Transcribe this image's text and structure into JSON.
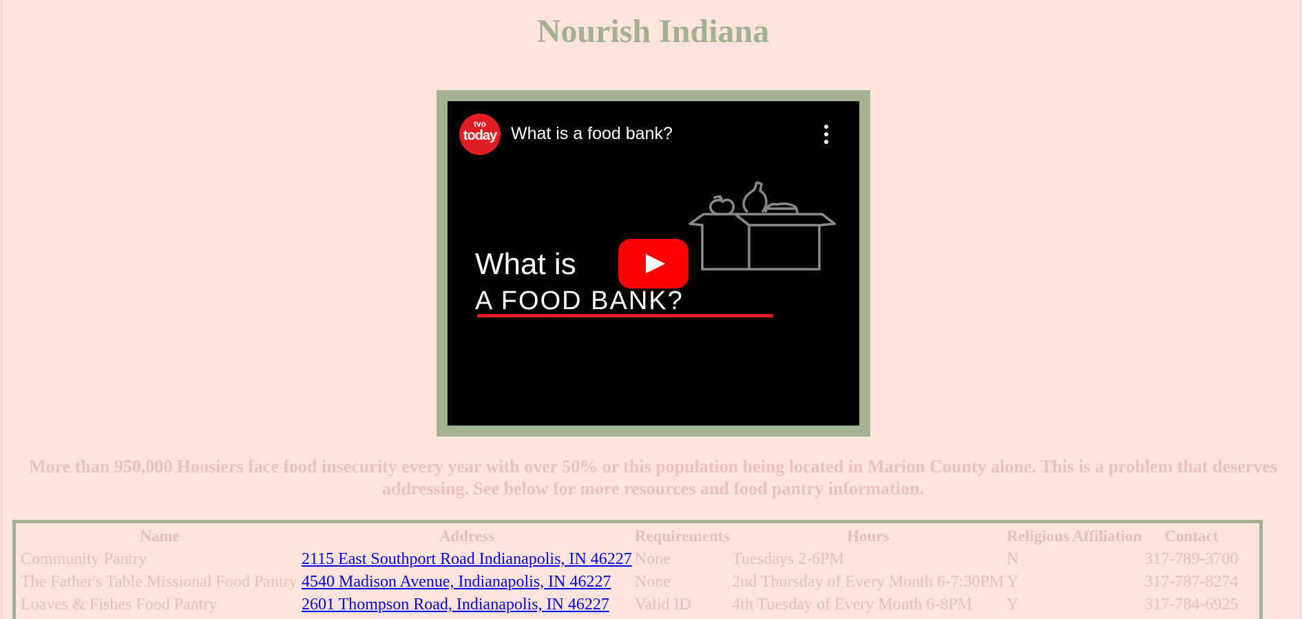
{
  "page": {
    "title": "Nourish Indiana",
    "description": "More than 950,000 Hoosiers face food insecurity every year with over 50% or this population being located in Marion County alone. This is a problem that deserves addressing. See below for more resources and food pantry information."
  },
  "video": {
    "channel_small": "tvo",
    "channel_big": "today",
    "title": "What is a food bank?",
    "thumb_line1": "What is",
    "thumb_line2": "A FOOD BANK?",
    "icons": [
      "channel-logo",
      "more-vertical-icon",
      "play-icon",
      "food-box-icon"
    ]
  },
  "table": {
    "headers": [
      "Name",
      "Address",
      "Requirements",
      "Hours",
      "Religious Affiliation",
      "Contact"
    ],
    "rows": [
      {
        "name": "Community Pantry",
        "address": "2115 East Southport Road Indianapolis, IN 46227",
        "requirements": "None",
        "hours": "Tuesdays 2-6PM",
        "religious": "N",
        "contact": "317-789-3700"
      },
      {
        "name": "The Father's Table Missional Food Pantry",
        "address": "4540 Madison Avenue, Indianapolis, IN 46227",
        "requirements": "None",
        "hours": "2nd Thursday of Every Month 6-7:30PM",
        "religious": "Y",
        "contact": "317-787-8274"
      },
      {
        "name": "Loaves & Fishes Food Pantry",
        "address": "2601 Thompson Road, Indianapolis, IN 46227",
        "requirements": "Valid ID",
        "hours": "4th Tuesday of Every Month 6-8PM",
        "religious": "Y",
        "contact": "317-784-6925"
      }
    ]
  },
  "colors": {
    "background": "#ffe4de",
    "accent_green": "#a3b092",
    "muted_text": "#e4c0b9",
    "link": "#0000ee",
    "video_red": "#ff0000"
  }
}
